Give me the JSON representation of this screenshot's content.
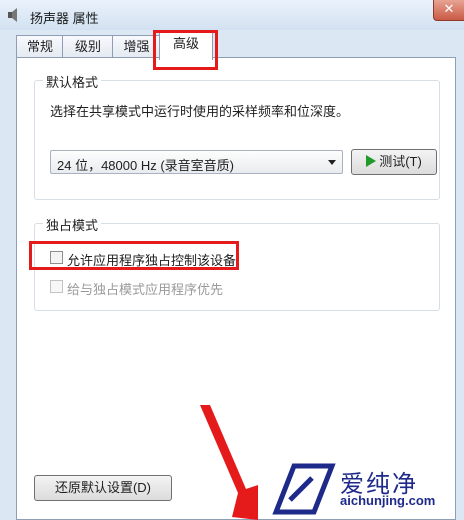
{
  "window": {
    "title": "扬声器 属性",
    "close_label": "✕"
  },
  "tabs": [
    {
      "label": "常规"
    },
    {
      "label": "级别"
    },
    {
      "label": "增强"
    },
    {
      "label": "高级"
    }
  ],
  "default_format": {
    "legend": "默认格式",
    "description": "选择在共享模式中运行时使用的采样频率和位深度。",
    "selected": "24 位，48000 Hz (录音室音质)",
    "test_button": "测试(T)"
  },
  "exclusive_mode": {
    "legend": "独占模式",
    "allow_label": "允许应用程序独占控制该设备",
    "priority_label": "给与独占模式应用程序优先"
  },
  "restore_defaults_button": "还原默认设置(D)",
  "watermark": {
    "text": "爱纯净",
    "url": "aichunjing.com"
  },
  "colors": {
    "highlight": "#e51b1b",
    "watermark": "#1d2a8a"
  }
}
